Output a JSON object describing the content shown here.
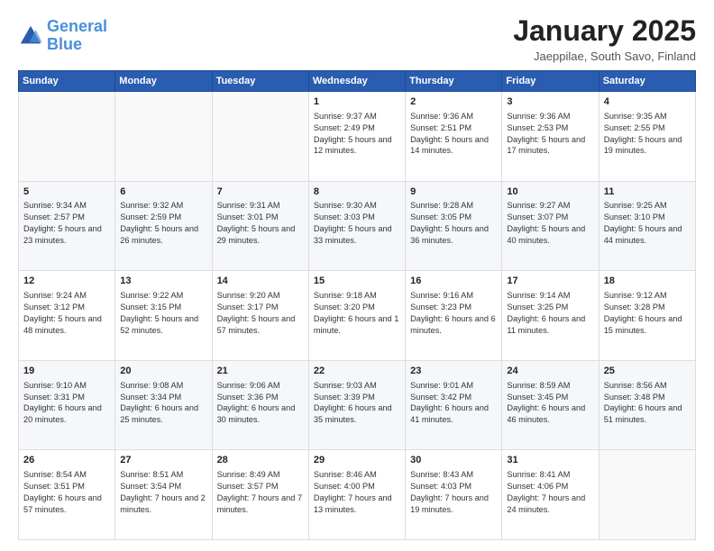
{
  "header": {
    "logo_line1": "General",
    "logo_line2": "Blue",
    "month": "January 2025",
    "location": "Jaeppilae, South Savo, Finland"
  },
  "days_of_week": [
    "Sunday",
    "Monday",
    "Tuesday",
    "Wednesday",
    "Thursday",
    "Friday",
    "Saturday"
  ],
  "weeks": [
    [
      {
        "day": "",
        "info": ""
      },
      {
        "day": "",
        "info": ""
      },
      {
        "day": "",
        "info": ""
      },
      {
        "day": "1",
        "info": "Sunrise: 9:37 AM\nSunset: 2:49 PM\nDaylight: 5 hours\nand 12 minutes."
      },
      {
        "day": "2",
        "info": "Sunrise: 9:36 AM\nSunset: 2:51 PM\nDaylight: 5 hours\nand 14 minutes."
      },
      {
        "day": "3",
        "info": "Sunrise: 9:36 AM\nSunset: 2:53 PM\nDaylight: 5 hours\nand 17 minutes."
      },
      {
        "day": "4",
        "info": "Sunrise: 9:35 AM\nSunset: 2:55 PM\nDaylight: 5 hours\nand 19 minutes."
      }
    ],
    [
      {
        "day": "5",
        "info": "Sunrise: 9:34 AM\nSunset: 2:57 PM\nDaylight: 5 hours\nand 23 minutes."
      },
      {
        "day": "6",
        "info": "Sunrise: 9:32 AM\nSunset: 2:59 PM\nDaylight: 5 hours\nand 26 minutes."
      },
      {
        "day": "7",
        "info": "Sunrise: 9:31 AM\nSunset: 3:01 PM\nDaylight: 5 hours\nand 29 minutes."
      },
      {
        "day": "8",
        "info": "Sunrise: 9:30 AM\nSunset: 3:03 PM\nDaylight: 5 hours\nand 33 minutes."
      },
      {
        "day": "9",
        "info": "Sunrise: 9:28 AM\nSunset: 3:05 PM\nDaylight: 5 hours\nand 36 minutes."
      },
      {
        "day": "10",
        "info": "Sunrise: 9:27 AM\nSunset: 3:07 PM\nDaylight: 5 hours\nand 40 minutes."
      },
      {
        "day": "11",
        "info": "Sunrise: 9:25 AM\nSunset: 3:10 PM\nDaylight: 5 hours\nand 44 minutes."
      }
    ],
    [
      {
        "day": "12",
        "info": "Sunrise: 9:24 AM\nSunset: 3:12 PM\nDaylight: 5 hours\nand 48 minutes."
      },
      {
        "day": "13",
        "info": "Sunrise: 9:22 AM\nSunset: 3:15 PM\nDaylight: 5 hours\nand 52 minutes."
      },
      {
        "day": "14",
        "info": "Sunrise: 9:20 AM\nSunset: 3:17 PM\nDaylight: 5 hours\nand 57 minutes."
      },
      {
        "day": "15",
        "info": "Sunrise: 9:18 AM\nSunset: 3:20 PM\nDaylight: 6 hours\nand 1 minute."
      },
      {
        "day": "16",
        "info": "Sunrise: 9:16 AM\nSunset: 3:23 PM\nDaylight: 6 hours\nand 6 minutes."
      },
      {
        "day": "17",
        "info": "Sunrise: 9:14 AM\nSunset: 3:25 PM\nDaylight: 6 hours\nand 11 minutes."
      },
      {
        "day": "18",
        "info": "Sunrise: 9:12 AM\nSunset: 3:28 PM\nDaylight: 6 hours\nand 15 minutes."
      }
    ],
    [
      {
        "day": "19",
        "info": "Sunrise: 9:10 AM\nSunset: 3:31 PM\nDaylight: 6 hours\nand 20 minutes."
      },
      {
        "day": "20",
        "info": "Sunrise: 9:08 AM\nSunset: 3:34 PM\nDaylight: 6 hours\nand 25 minutes."
      },
      {
        "day": "21",
        "info": "Sunrise: 9:06 AM\nSunset: 3:36 PM\nDaylight: 6 hours\nand 30 minutes."
      },
      {
        "day": "22",
        "info": "Sunrise: 9:03 AM\nSunset: 3:39 PM\nDaylight: 6 hours\nand 35 minutes."
      },
      {
        "day": "23",
        "info": "Sunrise: 9:01 AM\nSunset: 3:42 PM\nDaylight: 6 hours\nand 41 minutes."
      },
      {
        "day": "24",
        "info": "Sunrise: 8:59 AM\nSunset: 3:45 PM\nDaylight: 6 hours\nand 46 minutes."
      },
      {
        "day": "25",
        "info": "Sunrise: 8:56 AM\nSunset: 3:48 PM\nDaylight: 6 hours\nand 51 minutes."
      }
    ],
    [
      {
        "day": "26",
        "info": "Sunrise: 8:54 AM\nSunset: 3:51 PM\nDaylight: 6 hours\nand 57 minutes."
      },
      {
        "day": "27",
        "info": "Sunrise: 8:51 AM\nSunset: 3:54 PM\nDaylight: 7 hours\nand 2 minutes."
      },
      {
        "day": "28",
        "info": "Sunrise: 8:49 AM\nSunset: 3:57 PM\nDaylight: 7 hours\nand 7 minutes."
      },
      {
        "day": "29",
        "info": "Sunrise: 8:46 AM\nSunset: 4:00 PM\nDaylight: 7 hours\nand 13 minutes."
      },
      {
        "day": "30",
        "info": "Sunrise: 8:43 AM\nSunset: 4:03 PM\nDaylight: 7 hours\nand 19 minutes."
      },
      {
        "day": "31",
        "info": "Sunrise: 8:41 AM\nSunset: 4:06 PM\nDaylight: 7 hours\nand 24 minutes."
      },
      {
        "day": "",
        "info": ""
      }
    ]
  ]
}
